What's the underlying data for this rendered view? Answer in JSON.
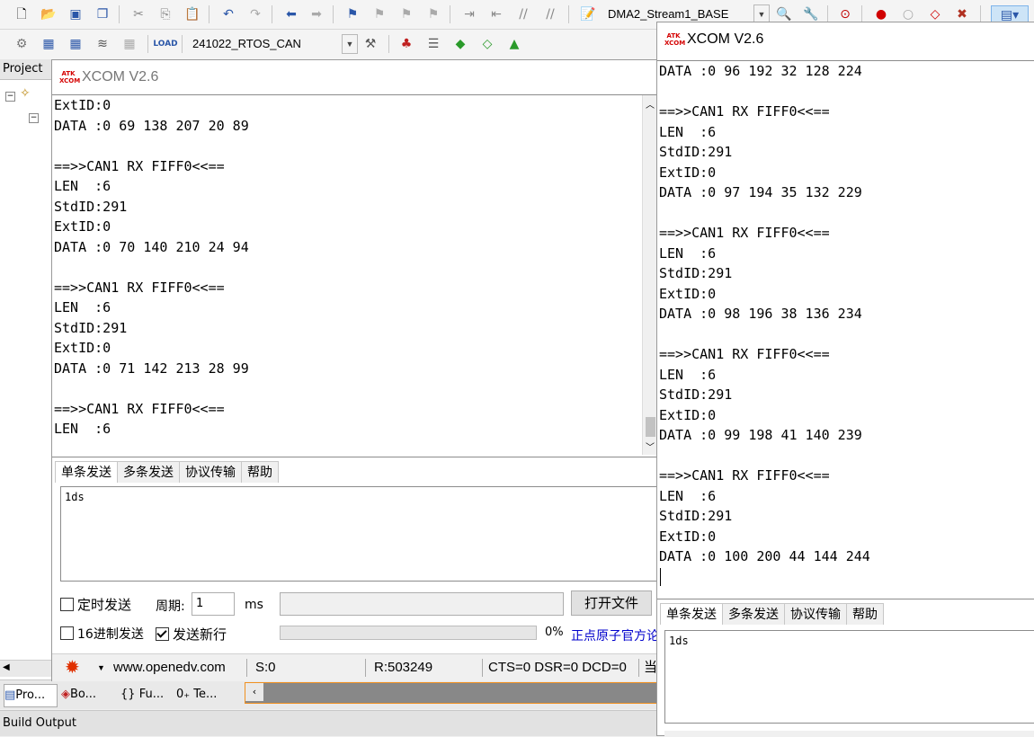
{
  "ide": {
    "target_combo": "DMA2_Stream1_BASE",
    "project_combo": "241022_RTOS_CAN",
    "project_panel_title": "Project",
    "bottom_tabs": [
      "Pro...",
      "Bo...",
      "Fu...",
      "Te..."
    ],
    "build_output_label": "Build Output"
  },
  "left_window": {
    "title": "XCOM V2.6",
    "logo_text": "ATK XCOM",
    "rx_lines": [
      "ExtID:0",
      "DATA :0 69 138 207 20 89",
      "",
      "==>>CAN1 RX FIFF0<<==",
      "LEN  :6",
      "StdID:291",
      "ExtID:0",
      "DATA :0 70 140 210 24 94",
      "",
      "==>>CAN1 RX FIFF0<<==",
      "LEN  :6",
      "StdID:291",
      "ExtID:0",
      "DATA :0 71 142 213 28 99",
      "",
      "==>>CAN1 RX FIFF0<<==",
      "LEN  :6"
    ],
    "tabs": [
      "单条发送",
      "多条发送",
      "协议传输",
      "帮助"
    ],
    "send_text": "1ds",
    "timed_send_label": "定时发送",
    "period_label": "周期:",
    "period_value": "1",
    "period_unit": "ms",
    "open_file_button": "打开文件",
    "hex_send_label": "16进制发送",
    "send_newline_label": "发送新行",
    "progress_text": "0%",
    "link_text": "正点原子官方论坛",
    "status": {
      "website": "www.openedv.com",
      "sent": "S:0",
      "received": "R:503249",
      "lines": "CTS=0 DSR=0 DCD=0",
      "trailing": "当"
    }
  },
  "right_window": {
    "title": "XCOM V2.6",
    "logo_text": "ATK XCOM",
    "rx_lines": [
      "DATA :0 96 192 32 128 224",
      "",
      "==>>CAN1 RX FIFF0<<==",
      "LEN  :6",
      "StdID:291",
      "ExtID:0",
      "DATA :0 97 194 35 132 229",
      "",
      "==>>CAN1 RX FIFF0<<==",
      "LEN  :6",
      "StdID:291",
      "ExtID:0",
      "DATA :0 98 196 38 136 234",
      "",
      "==>>CAN1 RX FIFF0<<==",
      "LEN  :6",
      "StdID:291",
      "ExtID:0",
      "DATA :0 99 198 41 140 239",
      "",
      "==>>CAN1 RX FIFF0<<==",
      "LEN  :6",
      "StdID:291",
      "ExtID:0",
      "DATA :0 100 200 44 144 244"
    ],
    "tabs": [
      "单条发送",
      "多条发送",
      "协议传输",
      "帮助"
    ],
    "send_text": "1ds"
  }
}
